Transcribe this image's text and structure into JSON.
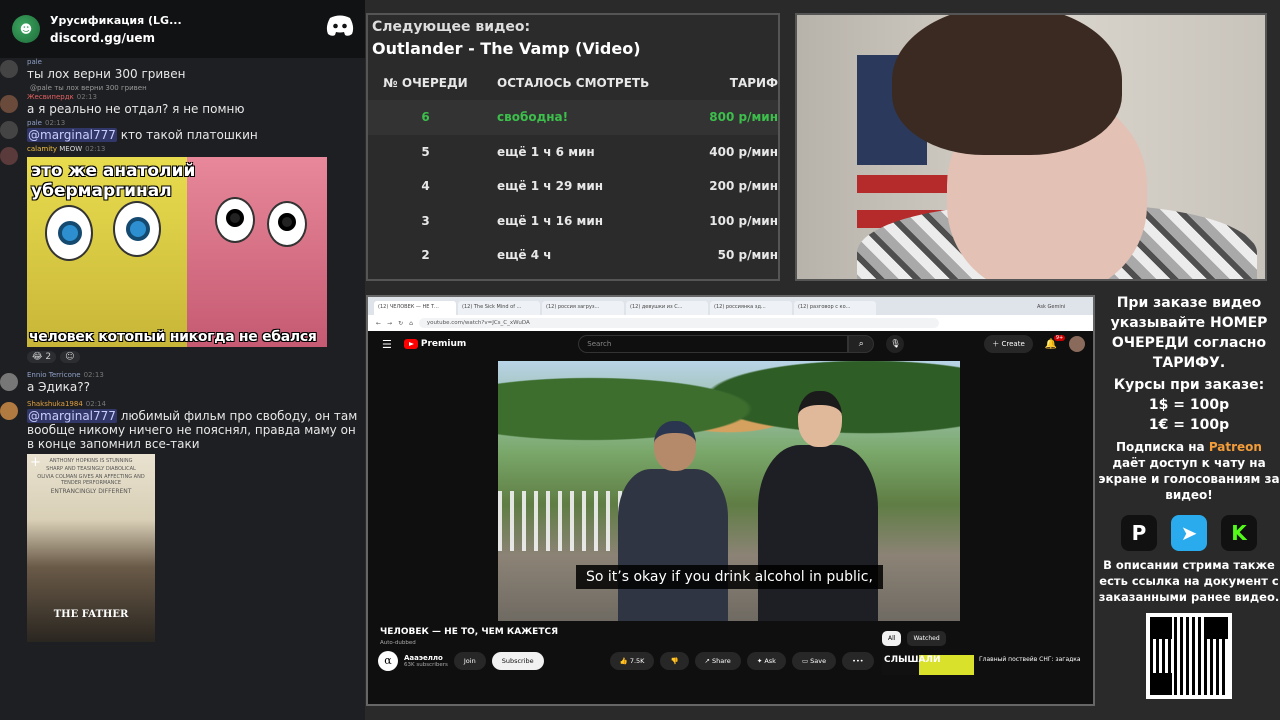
{
  "server": {
    "name": "Урусификация (LG...",
    "link": "discord.gg/uem"
  },
  "chat": {
    "messages": [
      {
        "author": "pale",
        "text": "ты лох верни 300 гривен",
        "time": ""
      },
      {
        "reply_to": "@pale ты лох верни 300 гривен",
        "author": "Жесвипердк",
        "time": "02:13",
        "text": "а я реально не отдал? я не помню"
      },
      {
        "author": "pale",
        "time": "02:13",
        "mention": "@marginal777",
        "text": "кто такой платошкин"
      },
      {
        "author": "calamity",
        "badge": "MEOW",
        "time": "02:13"
      },
      {
        "author": "Ennio Terricone",
        "time": "02:13",
        "text": "а Эдика??"
      },
      {
        "author": "Shakshuka1984",
        "time": "02:14",
        "mention": "@marginal777",
        "text": "любимый фильм про свободу, он там вообще никому ничего не пояснял, правда маму он в конце запомнил все-таки"
      }
    ],
    "meme": {
      "top": "это же анатолий убермаргинал",
      "bottom": "человек котопый никогда не ебался"
    },
    "reactions": [
      "😂 2",
      "☺"
    ],
    "poster": {
      "title": "THE FATHER",
      "lines": [
        "ANTHONY HOPKINS IS STUNNING",
        "SHARP AND TEASINGLY DIABOLICAL",
        "OLIVIA COLMAN GIVES AN AFFECTING AND TENDER PERFORMANCE",
        "ENTRANCINGLY DIFFERENT"
      ]
    }
  },
  "queue": {
    "next_label": "Следующее видео:",
    "next_title": "Outlander - The Vamp (Video)",
    "headers": [
      "№ ОЧЕРЕДИ",
      "ОСТАЛОСЬ СМОТРЕТЬ",
      "ТАРИФ"
    ],
    "rows": [
      {
        "num": "6",
        "remaining": "свободна!",
        "price": "800 р/мин"
      },
      {
        "num": "5",
        "remaining": "ещё 1 ч 6 мин",
        "price": "400 р/мин"
      },
      {
        "num": "4",
        "remaining": "ещё 1 ч 29 мин",
        "price": "200 р/мин"
      },
      {
        "num": "3",
        "remaining": "ещё 1 ч 16 мин",
        "price": "100 р/мин"
      },
      {
        "num": "2",
        "remaining": "ещё 4 ч",
        "price": "50 р/мин"
      }
    ]
  },
  "browser": {
    "tabs": [
      "(12) ЧЕЛОВЕК — НЕ Т...",
      "(12) The Sick Mind of ...",
      "(12) россия загруз...",
      "(12) девушки из С...",
      "(12) россиянка зд...",
      "(12) разговор с ко..."
    ],
    "ask_tab": "Ask Gemini",
    "url": "youtube.com/watch?v=JCs_C_xWuDA"
  },
  "youtube": {
    "logo": "Premium",
    "search_placeholder": "Search",
    "create": "Create",
    "notif_count": "9+",
    "caption": "So it’s okay if you drink alcohol in public,",
    "video_title": "ЧЕЛОВЕК — НЕ ТО, ЧЕМ КАЖЕТСЯ",
    "auto_dubbed": "Auto-dubbed",
    "channel_name": "Аааэелло",
    "channel_avatar": "α",
    "subscribers": "63K subscribers",
    "join": "Join",
    "subscribe": "Subscribe",
    "likes": "7.5K",
    "share": "Share",
    "ask": "Ask",
    "save": "Save",
    "more": "•••",
    "filter_all": "All",
    "filter_watched": "Watched",
    "side_thumb_text": "СЛЫШАЛИ",
    "side_title": "Главный поствейв СНГ: загадка"
  },
  "info": {
    "order": "При заказе видео указывайте НОМЕР ОЧЕРЕДИ согласно ТАРИФУ.",
    "courses_label": "Курсы при заказе:",
    "rate_usd": "1$ = 100р",
    "rate_eur": "1€ = 100р",
    "sub_before": "Подписка на",
    "sub_patreon": "Patreon",
    "sub_after": "даёт доступ к чату на экране и голосованиям за видео!",
    "desc": "В описании стрима также есть ссылка на документ с заказанными ранее видео."
  },
  "colors": {
    "accent_green": "#3cbf4b",
    "patreon": "#f39c3a",
    "youtube_red": "#ff0000"
  }
}
